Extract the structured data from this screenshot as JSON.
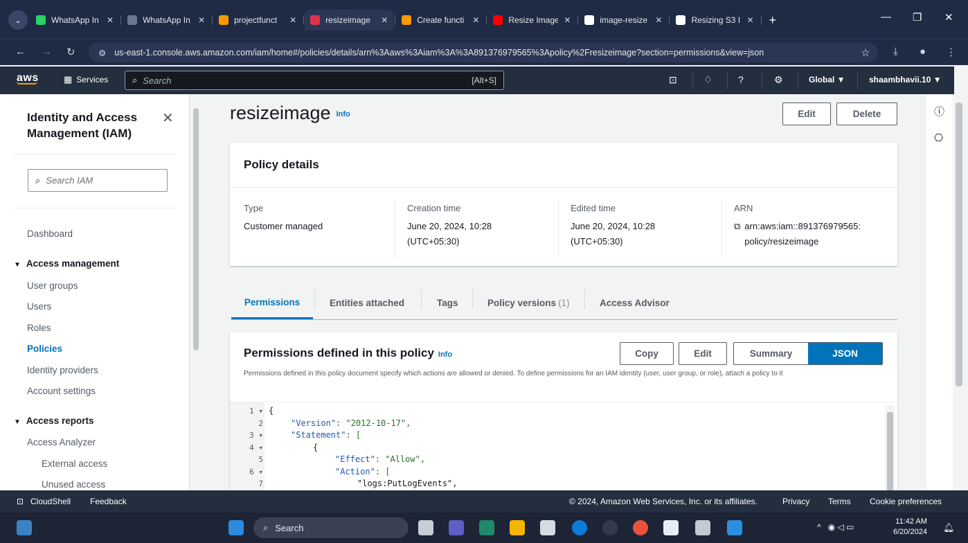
{
  "browser": {
    "tabs": [
      {
        "title": "WhatsApp In",
        "icon": "whatsapp-icon",
        "color": "#25d366"
      },
      {
        "title": "WhatsApp In",
        "icon": "globe-icon",
        "color": "#6b7690"
      },
      {
        "title": "projectfunct",
        "icon": "aws-icon",
        "color": "#ff9900"
      },
      {
        "title": "resizeimage",
        "icon": "iam-icon",
        "color": "#dd344c",
        "active": true
      },
      {
        "title": "Create functi",
        "icon": "aws-icon",
        "color": "#ff9900"
      },
      {
        "title": "Resize Image",
        "icon": "youtube-icon",
        "color": "#ff0000"
      },
      {
        "title": "image-resize",
        "icon": "github-icon",
        "color": "#ffffff"
      },
      {
        "title": "Resizing S3 I",
        "icon": "medium-icon",
        "color": "#ffffff"
      }
    ],
    "new_tab": "+",
    "url": "us-east-1.console.aws.amazon.com/iam/home#/policies/details/arn%3Aaws%3Aiam%3A%3A891376979565%3Apolicy%2Fresizeimage?section=permissions&view=json"
  },
  "aws_nav": {
    "logo": "aws",
    "services": "Services",
    "search_placeholder": "Search",
    "search_shortcut": "[Alt+S]",
    "region": "Global ▼",
    "account": "shaambhavii.10 ▼"
  },
  "sidebar": {
    "title": "Identity and Access Management (IAM)",
    "search_placeholder": "Search IAM",
    "dashboard": "Dashboard",
    "access_management": "Access management",
    "am_items": [
      "User groups",
      "Users",
      "Roles",
      "Policies",
      "Identity providers",
      "Account settings"
    ],
    "access_reports": "Access reports",
    "ar_items": [
      "Access Analyzer",
      "External access",
      "Unused access"
    ]
  },
  "policy": {
    "name": "resizeimage",
    "info": "Info",
    "edit": "Edit",
    "delete": "Delete",
    "details_header": "Policy details",
    "type_label": "Type",
    "type_value": "Customer managed",
    "creation_label": "Creation time",
    "creation_line1": "June 20, 2024, 10:28",
    "creation_line2": "(UTC+05:30)",
    "edited_label": "Edited time",
    "edited_line1": "June 20, 2024, 10:28",
    "edited_line2": "(UTC+05:30)",
    "arn_label": "ARN",
    "arn_line1": "arn:aws:iam::891376979565:",
    "arn_line2": "policy/resizeimage"
  },
  "tabs": {
    "permissions": "Permissions",
    "entities": "Entities attached",
    "tags": "Tags",
    "versions": "Policy versions",
    "versions_count": "(1)",
    "advisor": "Access Advisor"
  },
  "permissions": {
    "header": "Permissions defined in this policy",
    "info": "Info",
    "copy": "Copy",
    "edit": "Edit",
    "summary": "Summary",
    "json": "JSON",
    "description": "Permissions defined in this policy document specify which actions are allowed or denied. To define permissions for an IAM identity (user, user group, or role), attach a policy to it"
  },
  "editor": {
    "line_numbers": [
      "1 ▾",
      "2",
      "3 ▾",
      "4 ▾",
      "5",
      "6 ▾",
      "7"
    ],
    "lines": [
      {
        "indent": 0,
        "key": "",
        "text": "{"
      },
      {
        "indent": 1,
        "key": "\"Version\"",
        "text": ": \"2012-10-17\","
      },
      {
        "indent": 1,
        "key": "\"Statement\"",
        "text": ": ["
      },
      {
        "indent": 2,
        "key": "",
        "text": "{"
      },
      {
        "indent": 3,
        "key": "\"Effect\"",
        "text": ": \"Allow\","
      },
      {
        "indent": 3,
        "key": "\"Action\"",
        "text": ": ["
      },
      {
        "indent": 4,
        "key": "",
        "text": "\"logs:PutLogEvents\","
      }
    ]
  },
  "footer": {
    "cloudshell": "CloudShell",
    "feedback": "Feedback",
    "copyright": "© 2024, Amazon Web Services, Inc. or its affiliates.",
    "privacy": "Privacy",
    "terms": "Terms",
    "cookies": "Cookie preferences"
  },
  "taskbar": {
    "search": "Search",
    "time": "11:42 AM",
    "date": "6/20/2024"
  }
}
